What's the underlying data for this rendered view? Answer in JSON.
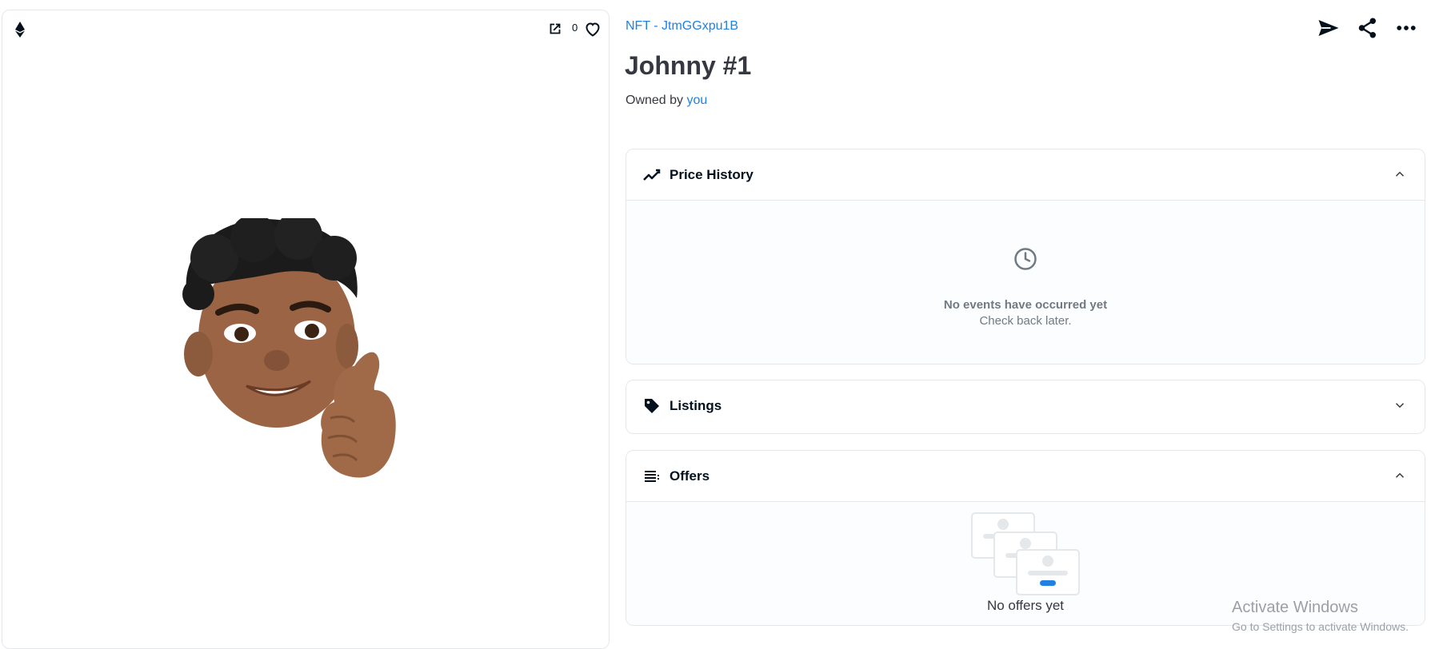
{
  "media": {
    "favorite_count": "0",
    "icons": {
      "chain": "ethereum-icon",
      "open": "open-in-new-icon",
      "favorite": "heart-icon"
    }
  },
  "item": {
    "collection_label": "NFT - JtmGGxpu1B",
    "title": "Johnny #1",
    "owned_by_prefix": "Owned by",
    "owner": "you"
  },
  "actions": {
    "icons": [
      "send-icon",
      "share-icon",
      "more-icon"
    ]
  },
  "panels": {
    "price_history": {
      "title": "Price History",
      "icon": "trending-line-icon",
      "expanded": true,
      "empty_title": "No events have occurred yet",
      "empty_subtitle": "Check back later."
    },
    "listings": {
      "title": "Listings",
      "icon": "tag-icon",
      "expanded": false
    },
    "offers": {
      "title": "Offers",
      "icon": "list-icon",
      "expanded": true,
      "empty_text": "No offers yet"
    }
  },
  "overlay": {
    "activate_title": "Activate Windows",
    "activate_subtitle": "Go to Settings to activate Windows."
  },
  "colors": {
    "link": "#2081e2",
    "text_dark": "#04111d",
    "text_muted": "#707a83",
    "border": "#e5e8eb"
  }
}
